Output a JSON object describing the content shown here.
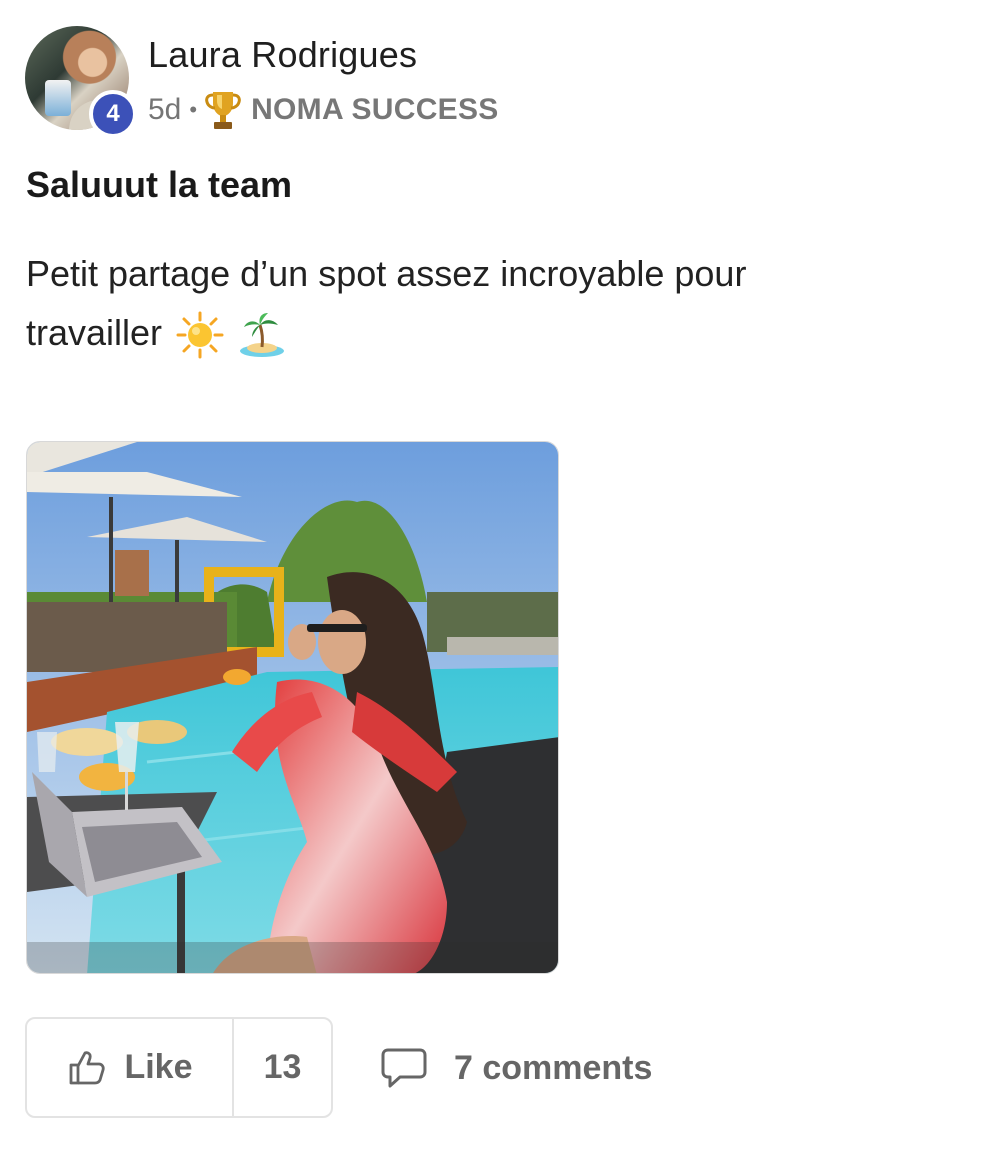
{
  "post": {
    "author": {
      "name": "Laura Rodrigues",
      "level": "4",
      "avatar_icon": "user-avatar-photo"
    },
    "meta": {
      "time_ago": "5d",
      "separator": "•",
      "category_icon": "trophy-icon",
      "category": "NOMA SUCCESS"
    },
    "title": "Saluuut la team",
    "body": "Petit partage d’un spot assez incroyable pour travailler",
    "body_emojis": [
      "sun-emoji",
      "desert-island-emoji"
    ],
    "image": {
      "description_icon": "post-photo"
    },
    "actions": {
      "like_label": "Like",
      "like_count": "13",
      "comments_label": "7 comments"
    }
  },
  "colors": {
    "level_badge": "#3c51b8",
    "muted_text": "#757575",
    "action_text": "#666666",
    "border": "#e3e3e3"
  }
}
